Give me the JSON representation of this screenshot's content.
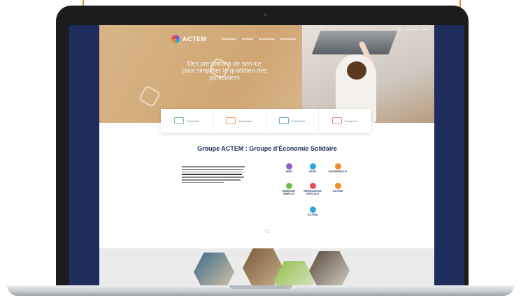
{
  "site": {
    "logo_text": "ACTEM",
    "nav": [
      "Particuliers",
      "Portfolio",
      "Association",
      "Entreprises"
    ],
    "topright": [
      "Accès",
      "Espace client",
      "Contact"
    ],
    "hero_title": "Des prestations de service pour simplifier le quotidien des particuliers",
    "cards": [
      {
        "label": "Particulier",
        "color": "#6fbf9a",
        "icon": "house-icon"
      },
      {
        "label": "Association",
        "color": "#f2a356",
        "icon": "people-icon"
      },
      {
        "label": "Collectivité",
        "color": "#5aa7d8",
        "icon": "building-icon"
      },
      {
        "label": "Entreprise",
        "color": "#e58aa0",
        "icon": "office-icon"
      }
    ],
    "section_title": "Groupe ACTEM : Groupe d'Économie Solidaire",
    "brands": [
      {
        "name": "AIDE",
        "color": "#8e5fc9"
      },
      {
        "name": "ATRE",
        "color": "#2fa6d9"
      },
      {
        "name": "PASSERELLE",
        "color": "#f28c28"
      },
      {
        "name": "ENERGIE EMPLOI",
        "color": "#6fbf4a"
      },
      {
        "name": "RESSOURCE VITICOLE",
        "color": "#e54d5e"
      },
      {
        "name": "ACTEM",
        "color": "#f28c28"
      },
      {
        "name": "ACTEM",
        "color": "#2fa6d9"
      }
    ]
  }
}
